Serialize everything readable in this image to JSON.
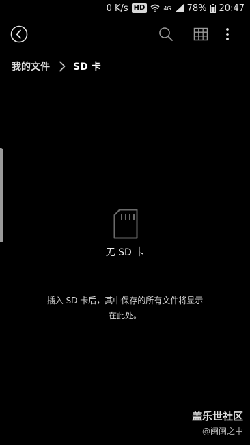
{
  "status_bar": {
    "speed": "0 K/s",
    "hd": "HD",
    "lte": "4G",
    "battery": "78%",
    "time": "20:47"
  },
  "toolbar": {
    "back_icon": "back-circle-icon",
    "search_icon": "search-icon",
    "grid_icon": "grid-view-icon",
    "more_icon": "more-vertical-icon"
  },
  "breadcrumb": {
    "home": "我的文件",
    "current": "SD 卡"
  },
  "empty_state": {
    "icon": "sd-card-icon",
    "title": "无 SD 卡",
    "message": "插入 SD 卡后，其中保存的所有文件将显示在此处。"
  },
  "watermark": {
    "brand": "盖乐世社区",
    "user": "@闽闽之中"
  }
}
